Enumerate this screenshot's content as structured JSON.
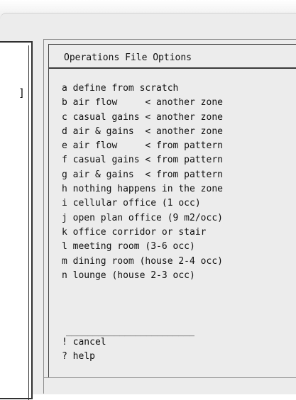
{
  "dialog": {
    "title": "Operations File Options",
    "items": [
      {
        "key": "a",
        "label": "a define from scratch"
      },
      {
        "key": "b",
        "label": "b air flow     < another zone"
      },
      {
        "key": "c",
        "label": "c casual gains < another zone"
      },
      {
        "key": "d",
        "label": "d air & gains  < another zone"
      },
      {
        "key": "e",
        "label": "e air flow     < from pattern"
      },
      {
        "key": "f",
        "label": "f casual gains < from pattern"
      },
      {
        "key": "g",
        "label": "g air & gains  < from pattern"
      },
      {
        "key": "h",
        "label": "h nothing happens in the zone"
      },
      {
        "key": "i",
        "label": "i cellular office (1 occ)"
      },
      {
        "key": "j",
        "label": "j open plan office (9 m2/occ)"
      },
      {
        "key": "k",
        "label": "k office corridor or stair"
      },
      {
        "key": "l",
        "label": "l meeting room (3-6 occ)"
      },
      {
        "key": "m",
        "label": "m dining room (house 2-4 occ)"
      },
      {
        "key": "n",
        "label": "n lounge (house 2-3 occ)"
      }
    ],
    "divider": "________________________",
    "footer": [
      {
        "key": "!",
        "label": "! cancel"
      },
      {
        "key": "?",
        "label": "? help"
      }
    ]
  },
  "left_panel": {
    "bracket": "]"
  }
}
